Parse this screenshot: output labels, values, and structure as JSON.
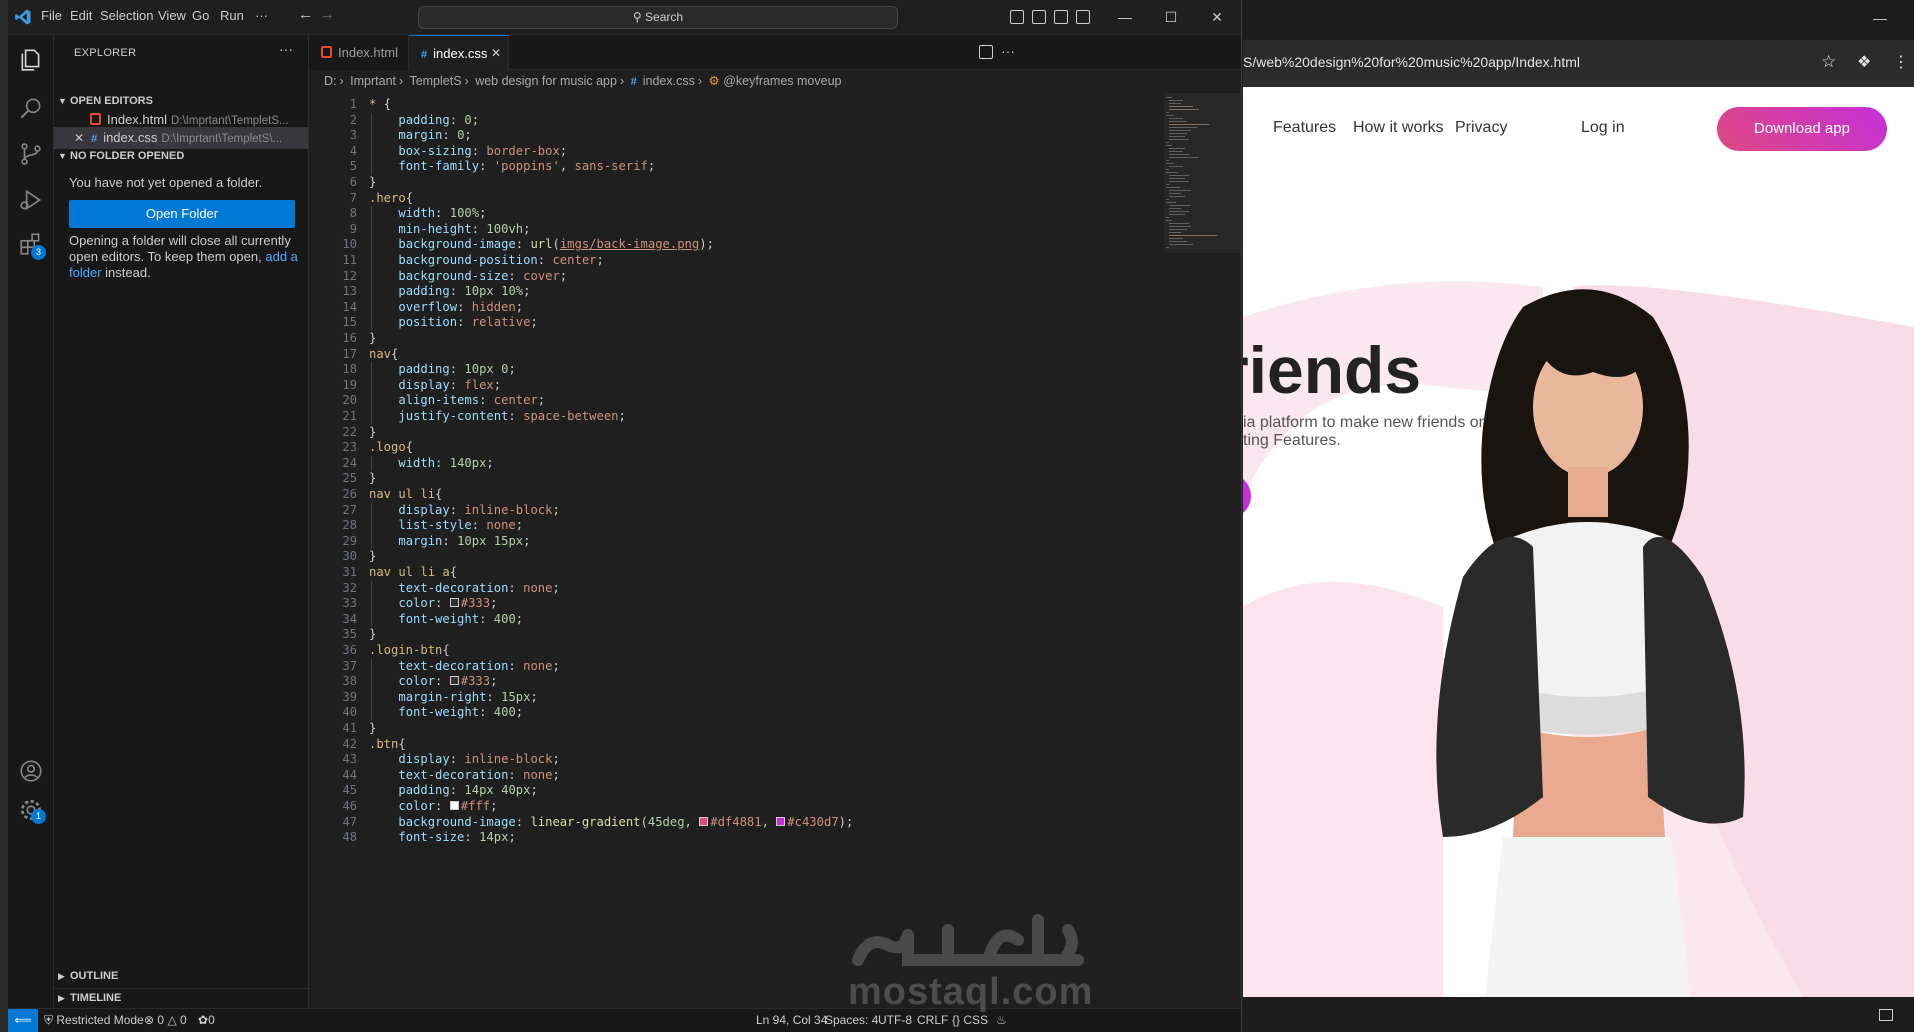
{
  "vscode": {
    "menu": [
      "File",
      "Edit",
      "Selection",
      "View",
      "Go",
      "Run",
      "···"
    ],
    "search_label": "Search",
    "explorer_title": "EXPLORER",
    "open_editors": {
      "header": "OPEN EDITORS",
      "items": [
        {
          "name": "Index.html",
          "path": "D:\\Imprtant\\TempletS..."
        },
        {
          "name": "index.css",
          "path": "D:\\Imprtant\\TempletS\\..."
        }
      ]
    },
    "no_folder": {
      "header": "NO FOLDER OPENED",
      "message": "You have not yet opened a folder.",
      "button": "Open Folder",
      "info_before": "Opening a folder will close all currently open editors. To keep them open,",
      "info_link": "add a folder",
      "info_after": "instead."
    },
    "outline_label": "OUTLINE",
    "timeline_label": "TIMELINE",
    "tabs": [
      {
        "label": "Index.html",
        "active": false
      },
      {
        "label": "index.css",
        "active": true
      }
    ],
    "breadcrumb": [
      "D:",
      "Imprtant",
      "TempletS",
      "web design for music app",
      "index.css",
      "@keyframes moveup"
    ],
    "badges": {
      "extensions": "3",
      "settings": "1"
    },
    "status": {
      "restricted": "Restricted Mode",
      "errors": "0",
      "warnings": "0",
      "ports": "0",
      "position": "Ln 94, Col 34",
      "spaces": "Spaces: 4",
      "encoding": "UTF-8",
      "eol": "CRLF",
      "language": "CSS"
    },
    "code_lines": [
      {
        "n": "1",
        "t": [
          [
            "sel",
            "* "
          ],
          [
            "",
            "{"
          ]
        ]
      },
      {
        "n": "2",
        "t": [
          [
            "",
            "    "
          ],
          [
            "prop",
            "padding"
          ],
          [
            "",
            ": "
          ],
          [
            "num",
            "0"
          ],
          [
            "",
            ";"
          ]
        ]
      },
      {
        "n": "3",
        "t": [
          [
            "",
            "    "
          ],
          [
            "prop",
            "margin"
          ],
          [
            "",
            ": "
          ],
          [
            "num",
            "0"
          ],
          [
            "",
            ";"
          ]
        ]
      },
      {
        "n": "4",
        "t": [
          [
            "",
            "    "
          ],
          [
            "prop",
            "box-sizing"
          ],
          [
            "",
            ": "
          ],
          [
            "val",
            "border-box"
          ],
          [
            "",
            ";"
          ]
        ]
      },
      {
        "n": "5",
        "t": [
          [
            "",
            "    "
          ],
          [
            "prop",
            "font-family"
          ],
          [
            "",
            ": "
          ],
          [
            "val",
            "'poppins'"
          ],
          [
            "",
            ", "
          ],
          [
            "val",
            "sans-serif"
          ],
          [
            "",
            ";"
          ]
        ]
      },
      {
        "n": "6",
        "t": [
          [
            "",
            "}"
          ]
        ]
      },
      {
        "n": "7",
        "t": [
          [
            "sel",
            ".hero"
          ],
          [
            "",
            "{"
          ]
        ]
      },
      {
        "n": "8",
        "t": [
          [
            "",
            "    "
          ],
          [
            "prop",
            "width"
          ],
          [
            "",
            ": "
          ],
          [
            "num",
            "100%"
          ],
          [
            "",
            ";"
          ]
        ]
      },
      {
        "n": "9",
        "t": [
          [
            "",
            "    "
          ],
          [
            "prop",
            "min-height"
          ],
          [
            "",
            ": "
          ],
          [
            "num",
            "100vh"
          ],
          [
            "",
            ";"
          ]
        ]
      },
      {
        "n": "10",
        "t": [
          [
            "",
            "    "
          ],
          [
            "prop",
            "background-image"
          ],
          [
            "",
            ": "
          ],
          [
            "fn",
            "url"
          ],
          [
            "",
            "("
          ],
          [
            "url",
            "imgs/back-image.png"
          ],
          [
            "",
            ");"
          ]
        ]
      },
      {
        "n": "11",
        "t": [
          [
            "",
            "    "
          ],
          [
            "prop",
            "background-position"
          ],
          [
            "",
            ": "
          ],
          [
            "val",
            "center"
          ],
          [
            "",
            ";"
          ]
        ]
      },
      {
        "n": "12",
        "t": [
          [
            "",
            "    "
          ],
          [
            "prop",
            "background-size"
          ],
          [
            "",
            ": "
          ],
          [
            "val",
            "cover"
          ],
          [
            "",
            ";"
          ]
        ]
      },
      {
        "n": "13",
        "t": [
          [
            "",
            "    "
          ],
          [
            "prop",
            "padding"
          ],
          [
            "",
            ": "
          ],
          [
            "num",
            "10px 10%"
          ],
          [
            "",
            ";"
          ]
        ]
      },
      {
        "n": "14",
        "t": [
          [
            "",
            "    "
          ],
          [
            "prop",
            "overflow"
          ],
          [
            "",
            ": "
          ],
          [
            "val",
            "hidden"
          ],
          [
            "",
            ";"
          ]
        ]
      },
      {
        "n": "15",
        "t": [
          [
            "",
            "    "
          ],
          [
            "prop",
            "position"
          ],
          [
            "",
            ": "
          ],
          [
            "val",
            "relative"
          ],
          [
            "",
            ";"
          ]
        ]
      },
      {
        "n": "16",
        "t": [
          [
            "",
            "}"
          ]
        ]
      },
      {
        "n": "17",
        "t": [
          [
            "sel",
            "nav"
          ],
          [
            "",
            "{"
          ]
        ]
      },
      {
        "n": "18",
        "t": [
          [
            "",
            "    "
          ],
          [
            "prop",
            "padding"
          ],
          [
            "",
            ": "
          ],
          [
            "num",
            "10px 0"
          ],
          [
            "",
            ";"
          ]
        ]
      },
      {
        "n": "19",
        "t": [
          [
            "",
            "    "
          ],
          [
            "prop",
            "display"
          ],
          [
            "",
            ": "
          ],
          [
            "val",
            "flex"
          ],
          [
            "",
            ";"
          ]
        ]
      },
      {
        "n": "20",
        "t": [
          [
            "",
            "    "
          ],
          [
            "prop",
            "align-items"
          ],
          [
            "",
            ": "
          ],
          [
            "val",
            "center"
          ],
          [
            "",
            ";"
          ]
        ]
      },
      {
        "n": "21",
        "t": [
          [
            "",
            "    "
          ],
          [
            "prop",
            "justify-content"
          ],
          [
            "",
            ": "
          ],
          [
            "val",
            "space-between"
          ],
          [
            "",
            ";"
          ]
        ]
      },
      {
        "n": "22",
        "t": [
          [
            "",
            "}"
          ]
        ]
      },
      {
        "n": "23",
        "t": [
          [
            "sel",
            ".logo"
          ],
          [
            "",
            "{"
          ]
        ]
      },
      {
        "n": "24",
        "t": [
          [
            "",
            "    "
          ],
          [
            "prop",
            "width"
          ],
          [
            "",
            ": "
          ],
          [
            "num",
            "140px"
          ],
          [
            "",
            ";"
          ]
        ]
      },
      {
        "n": "25",
        "t": [
          [
            "",
            "}"
          ]
        ]
      },
      {
        "n": "26",
        "t": [
          [
            "sel",
            "nav ul li"
          ],
          [
            "",
            "{"
          ]
        ]
      },
      {
        "n": "27",
        "t": [
          [
            "",
            "    "
          ],
          [
            "prop",
            "display"
          ],
          [
            "",
            ": "
          ],
          [
            "val",
            "inline-block"
          ],
          [
            "",
            ";"
          ]
        ]
      },
      {
        "n": "28",
        "t": [
          [
            "",
            "    "
          ],
          [
            "prop",
            "list-style"
          ],
          [
            "",
            ": "
          ],
          [
            "val",
            "none"
          ],
          [
            "",
            ";"
          ]
        ]
      },
      {
        "n": "29",
        "t": [
          [
            "",
            "    "
          ],
          [
            "prop",
            "margin"
          ],
          [
            "",
            ": "
          ],
          [
            "num",
            "10px 15px"
          ],
          [
            "",
            ";"
          ]
        ]
      },
      {
        "n": "30",
        "t": [
          [
            "",
            "}"
          ]
        ]
      },
      {
        "n": "31",
        "t": [
          [
            "sel",
            "nav ul li a"
          ],
          [
            "",
            "{"
          ]
        ]
      },
      {
        "n": "32",
        "t": [
          [
            "",
            "    "
          ],
          [
            "prop",
            "text-decoration"
          ],
          [
            "",
            ": "
          ],
          [
            "val",
            "none"
          ],
          [
            "",
            ";"
          ]
        ]
      },
      {
        "n": "33",
        "t": [
          [
            "",
            "    "
          ],
          [
            "prop",
            "color"
          ],
          [
            "",
            ": "
          ],
          [
            "swatch",
            "#333333"
          ],
          [
            "val",
            "#333"
          ],
          [
            "",
            ";"
          ]
        ]
      },
      {
        "n": "34",
        "t": [
          [
            "",
            "    "
          ],
          [
            "prop",
            "font-weight"
          ],
          [
            "",
            ": "
          ],
          [
            "num",
            "400"
          ],
          [
            "",
            ";"
          ]
        ]
      },
      {
        "n": "35",
        "t": [
          [
            "",
            "}"
          ]
        ]
      },
      {
        "n": "36",
        "t": [
          [
            "sel",
            ".login-btn"
          ],
          [
            "",
            "{"
          ]
        ]
      },
      {
        "n": "37",
        "t": [
          [
            "",
            "    "
          ],
          [
            "prop",
            "text-decoration"
          ],
          [
            "",
            ": "
          ],
          [
            "val",
            "none"
          ],
          [
            "",
            ";"
          ]
        ]
      },
      {
        "n": "38",
        "t": [
          [
            "",
            "    "
          ],
          [
            "prop",
            "color"
          ],
          [
            "",
            ": "
          ],
          [
            "swatch",
            "#333333"
          ],
          [
            "val",
            "#333"
          ],
          [
            "",
            ";"
          ]
        ]
      },
      {
        "n": "39",
        "t": [
          [
            "",
            "    "
          ],
          [
            "prop",
            "margin-right"
          ],
          [
            "",
            ": "
          ],
          [
            "num",
            "15px"
          ],
          [
            "",
            ";"
          ]
        ]
      },
      {
        "n": "40",
        "t": [
          [
            "",
            "    "
          ],
          [
            "prop",
            "font-weight"
          ],
          [
            "",
            ": "
          ],
          [
            "num",
            "400"
          ],
          [
            "",
            ";"
          ]
        ]
      },
      {
        "n": "41",
        "t": [
          [
            "",
            "}"
          ]
        ]
      },
      {
        "n": "42",
        "t": [
          [
            "sel",
            ".btn"
          ],
          [
            "",
            "{"
          ]
        ]
      },
      {
        "n": "43",
        "t": [
          [
            "",
            "    "
          ],
          [
            "prop",
            "display"
          ],
          [
            "",
            ": "
          ],
          [
            "val",
            "inline-block"
          ],
          [
            "",
            ";"
          ]
        ]
      },
      {
        "n": "44",
        "t": [
          [
            "",
            "    "
          ],
          [
            "prop",
            "text-decoration"
          ],
          [
            "",
            ": "
          ],
          [
            "val",
            "none"
          ],
          [
            "",
            ";"
          ]
        ]
      },
      {
        "n": "45",
        "t": [
          [
            "",
            "    "
          ],
          [
            "prop",
            "padding"
          ],
          [
            "",
            ": "
          ],
          [
            "num",
            "14px 40px"
          ],
          [
            "",
            ";"
          ]
        ]
      },
      {
        "n": "46",
        "t": [
          [
            "",
            "    "
          ],
          [
            "prop",
            "color"
          ],
          [
            "",
            ": "
          ],
          [
            "swatch",
            "#ffffff"
          ],
          [
            "val",
            "#fff"
          ],
          [
            "",
            ";"
          ]
        ]
      },
      {
        "n": "47",
        "t": [
          [
            "",
            "    "
          ],
          [
            "prop",
            "background-image"
          ],
          [
            "",
            ": "
          ],
          [
            "fn",
            "linear-gradient"
          ],
          [
            "",
            "("
          ],
          [
            "num",
            "45deg"
          ],
          [
            "",
            ", "
          ],
          [
            "swatch",
            "#df4881"
          ],
          [
            "val",
            "#df4881"
          ],
          [
            "",
            ", "
          ],
          [
            "swatch",
            "#c430d7"
          ],
          [
            "val",
            "#c430d7"
          ],
          [
            "",
            ");"
          ]
        ]
      },
      {
        "n": "48",
        "t": [
          [
            "",
            "    "
          ],
          [
            "prop",
            "font-size"
          ],
          [
            "",
            ": "
          ],
          [
            "num",
            "14px"
          ],
          [
            "",
            ";"
          ]
        ]
      }
    ]
  },
  "browser": {
    "url": "S/web%20design%20for%20music%20app/Index.html",
    "nav": [
      "Features",
      "How it works",
      "Privacy"
    ],
    "login": "Log in",
    "download": "Download app",
    "hero_title": "riends",
    "hero_text_1": "ia platform to make new friends onlin",
    "hero_text_2": "ting Features."
  },
  "watermark": {
    "latin": "mostaql.com"
  },
  "colors": {
    "accent": "#0078d4",
    "gradient_start": "#df4881",
    "gradient_end": "#c430d7"
  }
}
